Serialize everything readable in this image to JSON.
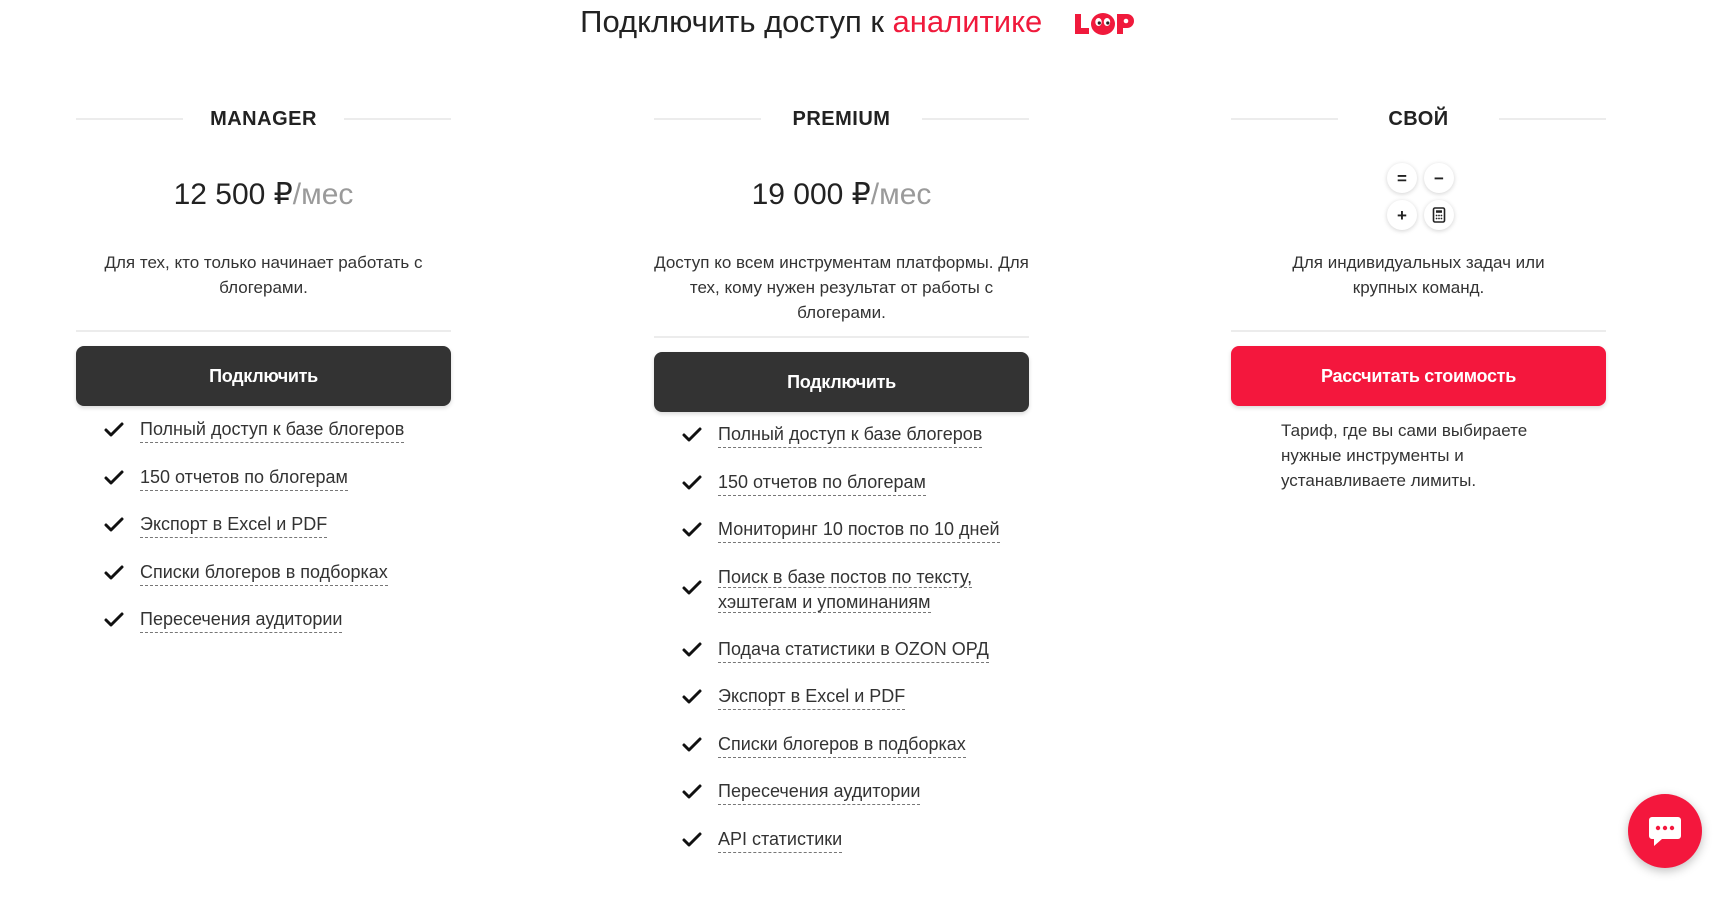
{
  "header": {
    "title_prefix": "Подключить доступ к",
    "title_accent": "аналитике",
    "logo_name": "lup-logo",
    "accent_color": "#f01a3c"
  },
  "plans": [
    {
      "name": "MANAGER",
      "price": "12 500 ₽",
      "per": "/мес",
      "description": "Для тех, кто только начинает работать с блогерами.",
      "button": "Подключить",
      "features": [
        "Полный доступ к базе блогеров",
        "150 отчетов по блогерам",
        "Экспорт в Excel и PDF",
        "Списки блогеров в подборках",
        "Пересечения аудитории"
      ]
    },
    {
      "name": "PREMIUM",
      "price": "19 000 ₽",
      "per": "/мес",
      "description": "Доступ ко всем инструментам платформы. Для тех, кому нужен результат от работы с блогерами.",
      "button": "Подключить",
      "features": [
        "Полный доступ к базе блогеров",
        "150 отчетов по блогерам",
        "Мониторинг 10 постов по 10 дней",
        "Поиск в базе постов по тексту, хэштегам и упоминаниям",
        "Подача статистики в OZON ОРД",
        "Экспорт в Excel и PDF",
        "Списки блогеров в подборках",
        "Пересечения аудитории",
        "API статистики"
      ]
    },
    {
      "name": "СВОЙ",
      "calculator_keys": [
        "=",
        "−",
        "+",
        "calculator-icon"
      ],
      "description": "Для индивидуальных задач или крупных команд.",
      "button": "Рассчитать стоимость",
      "note": "Тариф, где вы сами выбираете нужные инструменты и устанавливаете лимиты."
    }
  ],
  "colors": {
    "dark_button": "#333333",
    "red_button": "#f4173d",
    "muted_text": "#9a9a9a"
  },
  "chat": {
    "icon": "chat-bubble-icon"
  }
}
